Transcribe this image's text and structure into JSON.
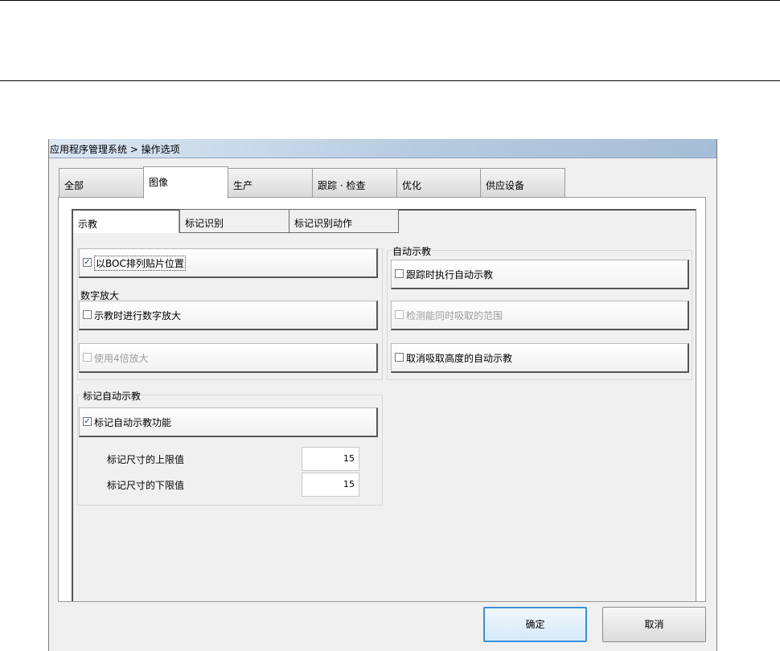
{
  "window": {
    "title": "应用程序管理系统 > 操作选项"
  },
  "tabs": [
    "全部",
    "图像",
    "生产",
    "跟踪 · 检查",
    "优化",
    "供应设备"
  ],
  "active_tab": "图像",
  "subtabs": [
    "示教",
    "标记识别",
    "标记识别动作"
  ],
  "active_subtab": "示教",
  "options": {
    "boc_position": {
      "label": "以BOC排列贴片位置",
      "checked": true
    },
    "digital_zoom_group": "数字放大",
    "teach_zoom": {
      "label": "示教时进行数字放大",
      "checked": false
    },
    "zoom4x": {
      "label": "使用4倍放大",
      "checked": false
    },
    "auto_teach_group": "自动示教",
    "tracking_auto": {
      "label": "跟踪时执行自动示教",
      "checked": false
    },
    "pick_range": {
      "label": "检测能同时吸取的范围",
      "checked": false
    },
    "cancel_height": {
      "label": "取消吸取高度的自动示教",
      "checked": false
    },
    "mark_group": "标记自动示教",
    "mark_auto": {
      "label": "标记自动示教功能",
      "checked": true
    },
    "upper_label": "标记尺寸的上限值",
    "upper_value": "15",
    "lower_label": "标记尺寸的下限值",
    "lower_value": "15"
  },
  "buttons": {
    "ok": "确定",
    "cancel": "取消"
  },
  "check_glyph": "✓"
}
